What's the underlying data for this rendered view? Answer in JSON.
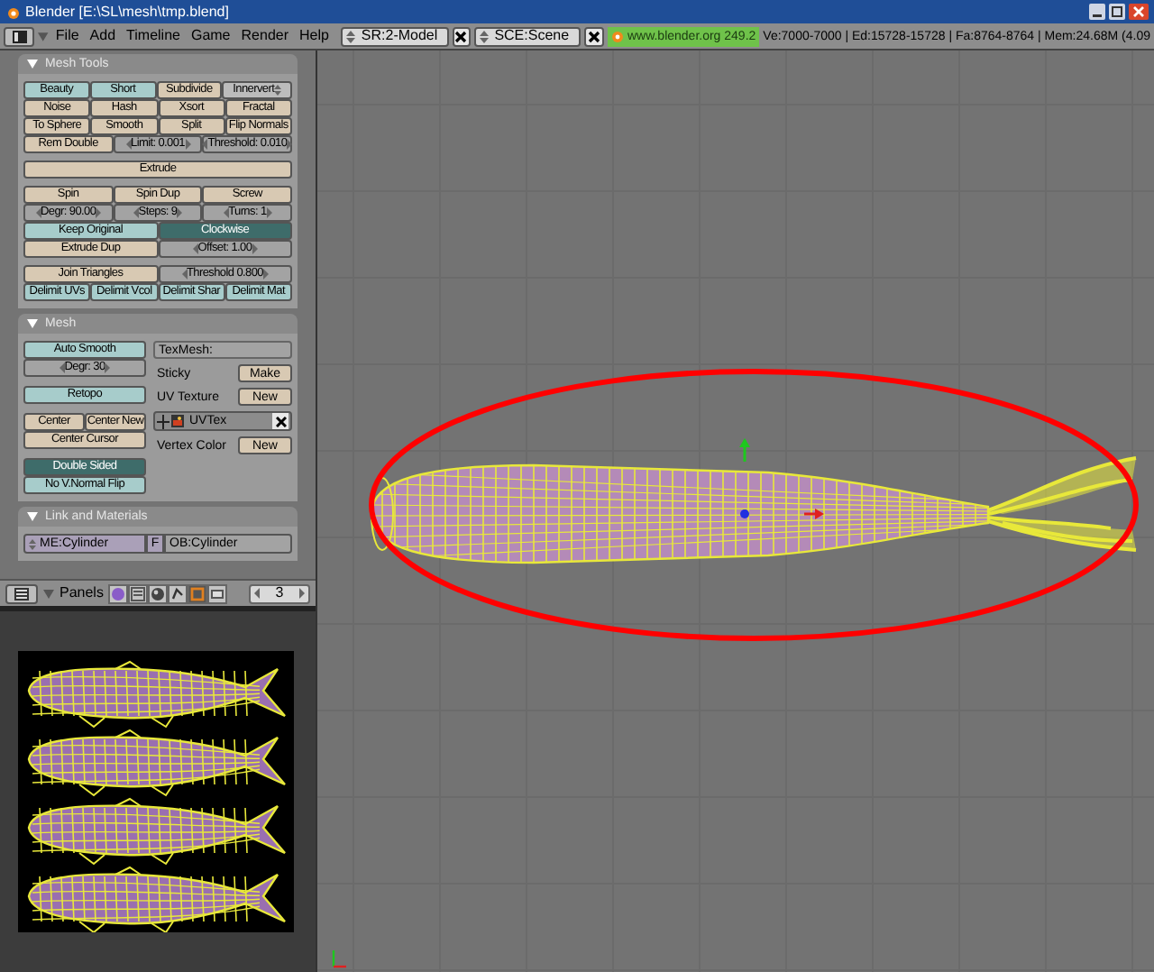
{
  "window": {
    "title": "Blender [E:\\SL\\mesh\\tmp.blend]"
  },
  "header": {
    "menus": [
      "File",
      "Add",
      "Timeline",
      "Game",
      "Render",
      "Help"
    ],
    "screen": "SR:2-Model",
    "scene": "SCE:Scene",
    "version": "www.blender.org 249.2",
    "stats": "Ve:7000-7000 | Ed:15728-15728 | Fa:8764-8764 | Mem:24.68M (4.09"
  },
  "mesh_tools": {
    "title": "Mesh Tools",
    "expanded": true,
    "groups": [
      [
        [
          {
            "label": "Beauty",
            "kind": "toggle",
            "selected": false
          },
          {
            "label": "Short",
            "kind": "toggle",
            "selected": false
          },
          {
            "label": "Subdivide",
            "kind": "button"
          },
          {
            "label": "Innervert",
            "kind": "menu"
          }
        ],
        [
          {
            "label": "Noise",
            "kind": "button"
          },
          {
            "label": "Hash",
            "kind": "button"
          },
          {
            "label": "Xsort",
            "kind": "button"
          },
          {
            "label": "Fractal",
            "kind": "button"
          }
        ],
        [
          {
            "label": "To Sphere",
            "kind": "button"
          },
          {
            "label": "Smooth",
            "kind": "button"
          },
          {
            "label": "Split",
            "kind": "button"
          },
          {
            "label": "Flip Normals",
            "kind": "button"
          }
        ],
        [
          {
            "label": "Rem Double",
            "kind": "button"
          },
          {
            "label": "Limit: 0.001",
            "kind": "number"
          },
          {
            "label": "Threshold: 0.010",
            "kind": "number"
          }
        ]
      ],
      [
        [
          {
            "label": "Extrude",
            "kind": "button"
          }
        ]
      ],
      [
        [
          {
            "label": "Spin",
            "kind": "button"
          },
          {
            "label": "Spin Dup",
            "kind": "button"
          },
          {
            "label": "Screw",
            "kind": "button"
          }
        ],
        [
          {
            "label": "Degr: 90.00",
            "kind": "number"
          },
          {
            "label": "Steps: 9",
            "kind": "number"
          },
          {
            "label": "Turns: 1",
            "kind": "number"
          }
        ],
        [
          {
            "label": "Keep Original",
            "kind": "toggle",
            "selected": false
          },
          {
            "label": "Clockwise",
            "kind": "toggle",
            "selected": true
          }
        ],
        [
          {
            "label": "Extrude Dup",
            "kind": "button"
          },
          {
            "label": "Offset: 1.00",
            "kind": "number"
          }
        ]
      ],
      [
        [
          {
            "label": "Join Triangles",
            "kind": "button"
          },
          {
            "label": "Threshold 0.800",
            "kind": "number"
          }
        ],
        [
          {
            "label": "Delimit UVs",
            "kind": "toggle",
            "selected": false
          },
          {
            "label": "Delimit Vcol",
            "kind": "toggle",
            "selected": false
          },
          {
            "label": "Delimit Shar",
            "kind": "toggle",
            "selected": false
          },
          {
            "label": "Delimit Mat",
            "kind": "toggle",
            "selected": false
          }
        ]
      ]
    ]
  },
  "mesh": {
    "title": "Mesh",
    "expanded": true,
    "left_groups": [
      [
        [
          {
            "label": "Auto Smooth",
            "kind": "toggle",
            "selected": false
          }
        ],
        [
          {
            "label": "Degr: 30",
            "kind": "number"
          }
        ]
      ],
      [
        [
          {
            "label": "Retopo",
            "kind": "toggle",
            "selected": false
          }
        ]
      ],
      [
        [
          {
            "label": "Center",
            "kind": "button"
          },
          {
            "label": "Center New",
            "kind": "button"
          }
        ],
        [
          {
            "label": "Center Cursor",
            "kind": "button"
          }
        ]
      ],
      [
        [
          {
            "label": "Double Sided",
            "kind": "toggle",
            "selected": true
          }
        ],
        [
          {
            "label": "No V.Normal Flip",
            "kind": "toggle",
            "selected": false
          }
        ]
      ]
    ],
    "right_items": [
      {
        "kind": "field",
        "label": "TexMesh:"
      },
      {
        "kind": "label_button",
        "label": "Sticky",
        "button": "Make"
      },
      {
        "kind": "label_button",
        "label": "UV Texture",
        "button": "New"
      },
      {
        "kind": "layer",
        "label": "UVTex"
      },
      {
        "kind": "label_button",
        "label": "Vertex Color",
        "button": "New"
      }
    ]
  },
  "link_materials": {
    "title": "Link and Materials",
    "expanded": true,
    "mesh": "ME:Cylinder",
    "fake": "F",
    "object": "OB:Cylinder"
  },
  "buttons_header": {
    "panels_label": "Panels",
    "layer": "3"
  }
}
